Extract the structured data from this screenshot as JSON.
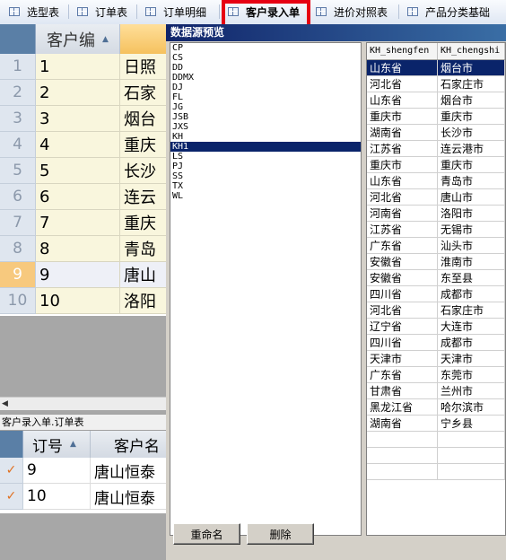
{
  "tabs": [
    {
      "label": "选型表"
    },
    {
      "label": "订单表"
    },
    {
      "label": "订单明细"
    },
    {
      "label": "客户录入单"
    },
    {
      "label": "进价对照表"
    },
    {
      "label": "产品分类基础"
    }
  ],
  "top_grid": {
    "header": "客户编",
    "rows": [
      {
        "num": "1",
        "id": "1",
        "name": "日照"
      },
      {
        "num": "2",
        "id": "2",
        "name": "石家"
      },
      {
        "num": "3",
        "id": "3",
        "name": "烟台"
      },
      {
        "num": "4",
        "id": "4",
        "name": "重庆"
      },
      {
        "num": "5",
        "id": "5",
        "name": "长沙"
      },
      {
        "num": "6",
        "id": "6",
        "name": "连云"
      },
      {
        "num": "7",
        "id": "7",
        "name": "重庆"
      },
      {
        "num": "8",
        "id": "8",
        "name": "青岛"
      },
      {
        "num": "9",
        "id": "9",
        "name": "唐山"
      },
      {
        "num": "10",
        "id": "10",
        "name": "洛阳"
      }
    ]
  },
  "bottom_section": {
    "title": "客户录入单.订单表",
    "headers": [
      "订号",
      "客户名"
    ],
    "rows": [
      {
        "order": "9",
        "customer": "唐山恒泰"
      },
      {
        "order": "10",
        "customer": "唐山恒泰"
      }
    ]
  },
  "dialog": {
    "title": "数据源预览",
    "table_list": [
      "CP",
      "CS",
      "DD",
      "DDMX",
      "DJ",
      "FL",
      "JG",
      "JSB",
      "JXS",
      "KH",
      "KH1",
      "LS",
      "PJ",
      "SS",
      "TX",
      "WL"
    ],
    "selected_table": "KH1",
    "preview": {
      "columns": [
        "KH_shengfen",
        "KH_chengshi"
      ],
      "rows": [
        [
          "山东省",
          "烟台市"
        ],
        [
          "河北省",
          "石家庄市"
        ],
        [
          "山东省",
          "烟台市"
        ],
        [
          "重庆市",
          "重庆市"
        ],
        [
          "湖南省",
          "长沙市"
        ],
        [
          "江苏省",
          "连云港市"
        ],
        [
          "重庆市",
          "重庆市"
        ],
        [
          "山东省",
          "青岛市"
        ],
        [
          "河北省",
          "唐山市"
        ],
        [
          "河南省",
          "洛阳市"
        ],
        [
          "江苏省",
          "无锡市"
        ],
        [
          "广东省",
          "汕头市"
        ],
        [
          "安徽省",
          "淮南市"
        ],
        [
          "安徽省",
          "东至县"
        ],
        [
          "四川省",
          "成都市"
        ],
        [
          "河北省",
          "石家庄市"
        ],
        [
          "辽宁省",
          "大连市"
        ],
        [
          "四川省",
          "成都市"
        ],
        [
          "天津市",
          "天津市"
        ],
        [
          "广东省",
          "东莞市"
        ],
        [
          "甘肃省",
          "兰州市"
        ],
        [
          "黑龙江省",
          "哈尔滨市"
        ],
        [
          "湖南省",
          "宁乡县"
        ]
      ]
    },
    "buttons": {
      "rename": "重命名",
      "delete": "删除"
    }
  }
}
